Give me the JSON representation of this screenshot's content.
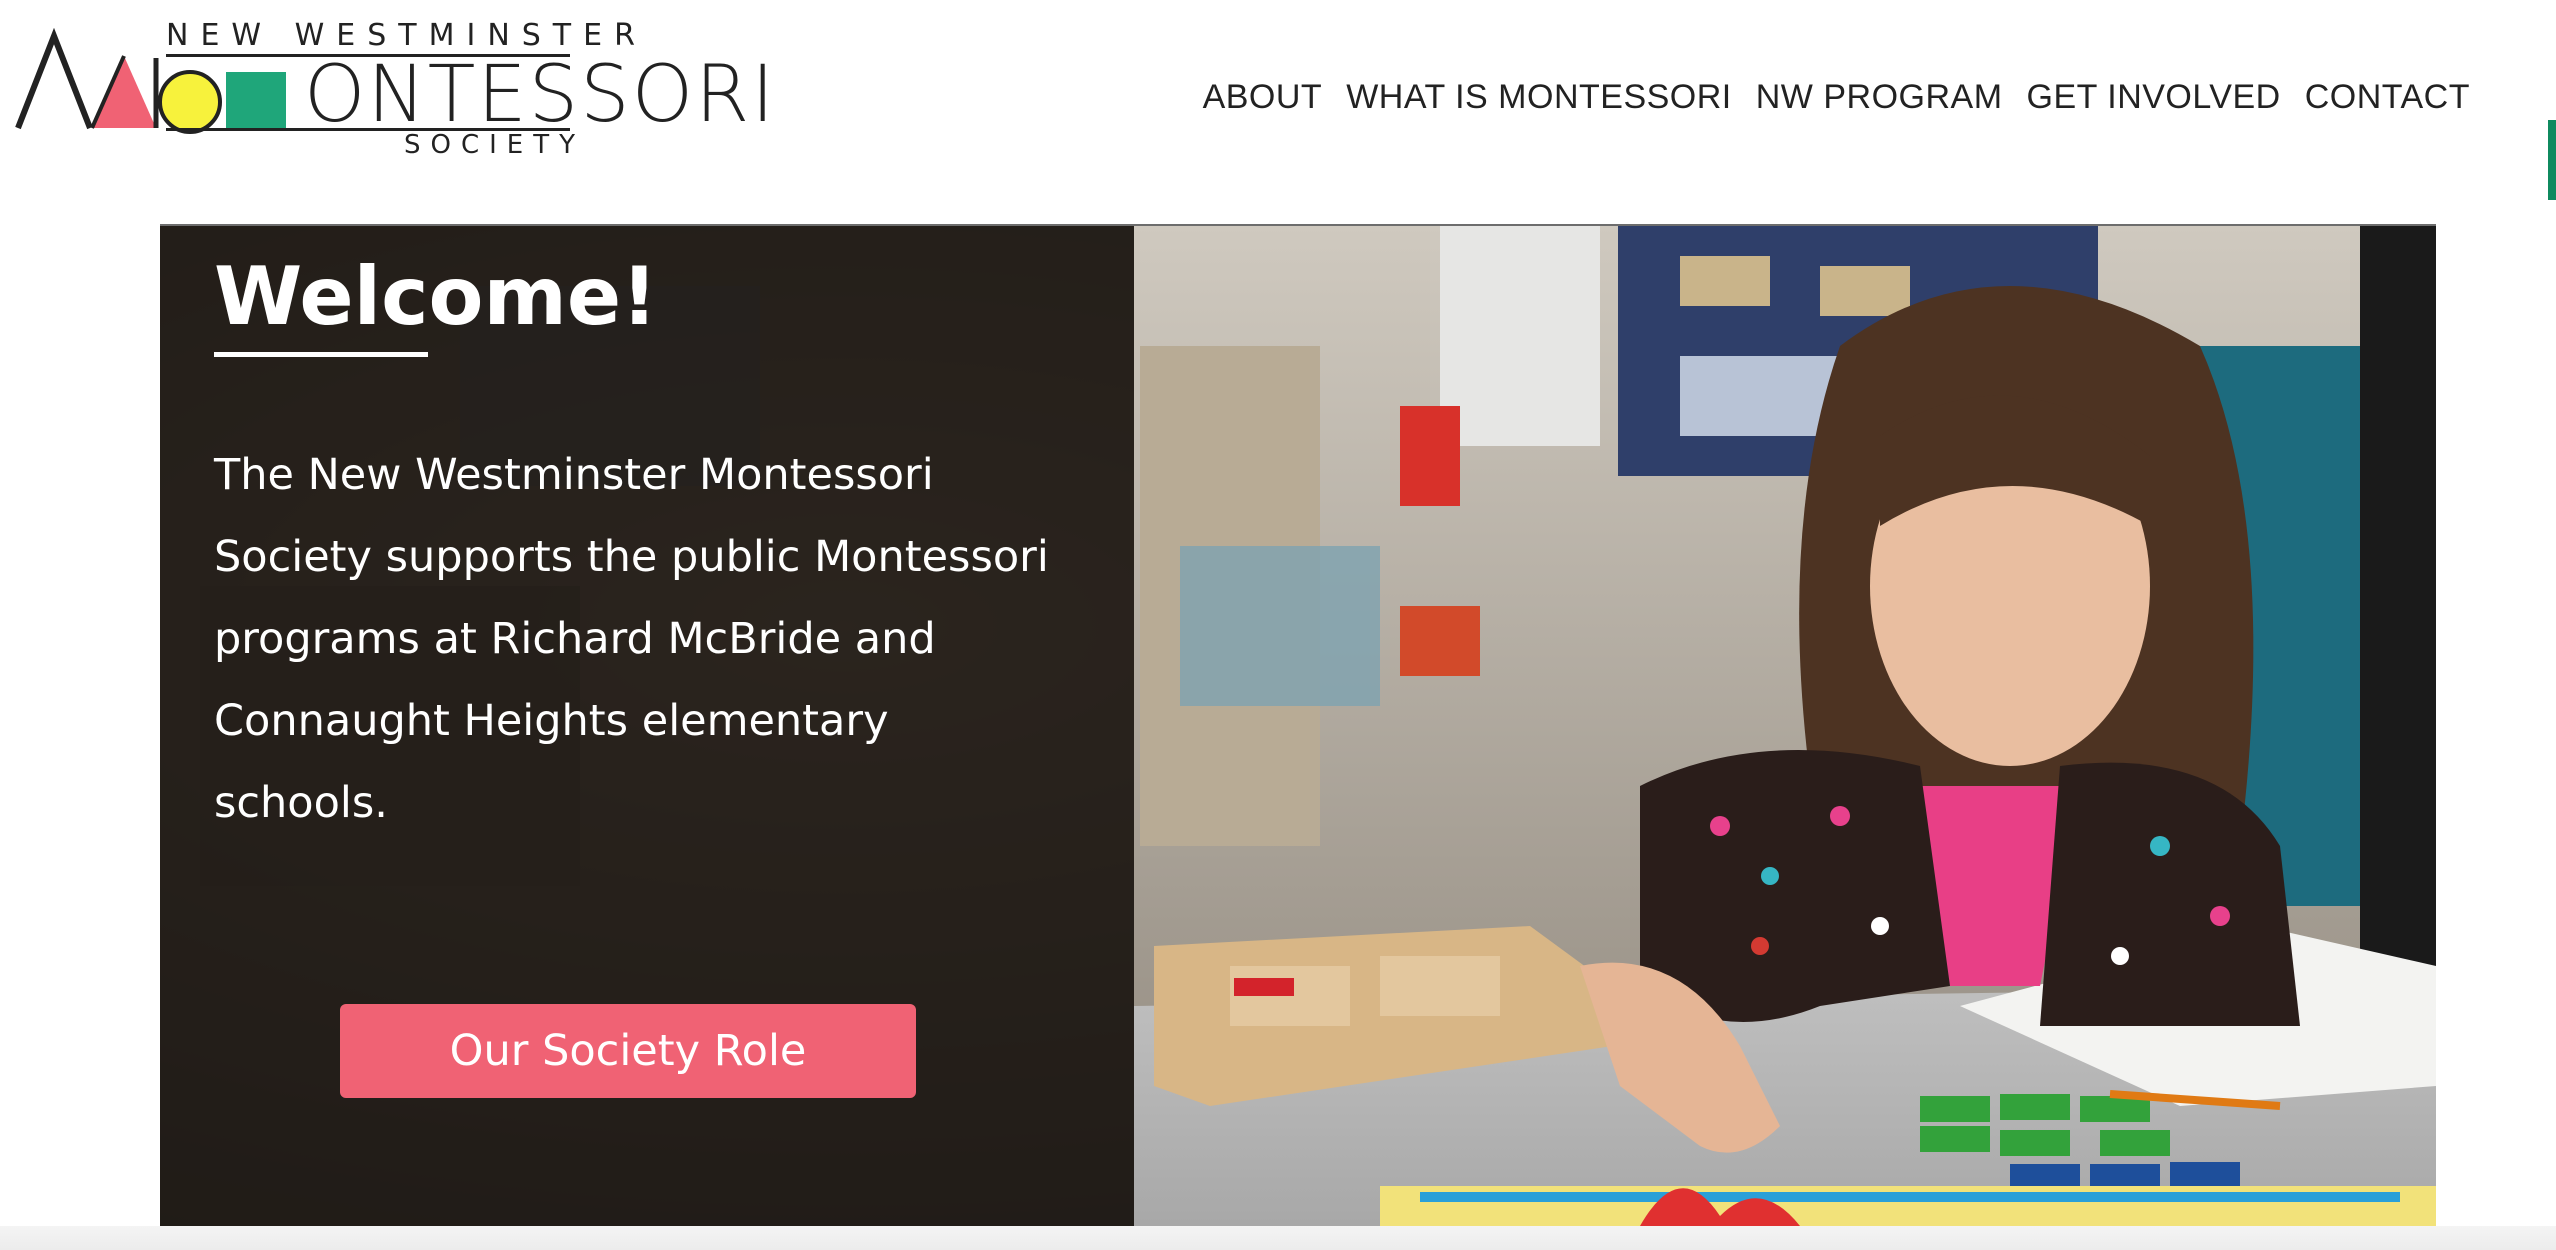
{
  "brand": {
    "line_top": "NEW WESTMINSTER",
    "line_main_prefix": "M",
    "line_main": "ONTESSORI",
    "line_bottom": "SOCIETY",
    "colors": {
      "pink": "#f06274",
      "yellow": "#f7f23c",
      "green": "#1fa67a",
      "ink": "#222222"
    }
  },
  "nav": {
    "items": [
      {
        "label": "ABOUT"
      },
      {
        "label": "WHAT IS MONTESSORI"
      },
      {
        "label": "NW PROGRAM"
      },
      {
        "label": "GET INVOLVED"
      },
      {
        "label": "CONTACT"
      }
    ]
  },
  "hero": {
    "title": "Welcome!",
    "text": "The New Westminster Montessori Society supports the public Montessori programs at Richard McBride and Connaught Heights elementary schools.",
    "button_label": "Our Society Role",
    "button_color": "#f06274"
  }
}
